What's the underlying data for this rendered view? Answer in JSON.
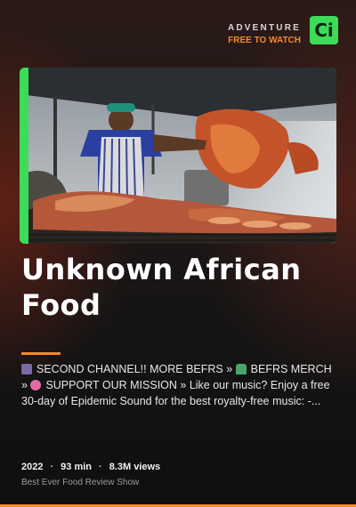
{
  "brand": {
    "network": "ADVENTURE",
    "tagline": "FREE TO WATCH",
    "logo_text": "Ci",
    "accent_color": "#3ddc58",
    "highlight_color": "#f28a2c"
  },
  "video": {
    "title_line1": "Unknown African",
    "title_line2": "Food",
    "description": [
      {
        "icon": "plate-emoji-icon",
        "text": "SECOND CHANNEL!! MORE BEFRS » "
      },
      {
        "icon": "tshirt-emoji-icon",
        "text": "BEFRS MERCH »"
      },
      {
        "icon": "heart-emoji-icon",
        "text": "SUPPORT OUR MISSION » Like our music? Enjoy a free 30-day of Epidemic Sound for the best royalty-free music: -..."
      }
    ],
    "year": "2022",
    "duration": "93 min",
    "views": "8.3M views",
    "channel": "Best Ever Food Review Show"
  }
}
